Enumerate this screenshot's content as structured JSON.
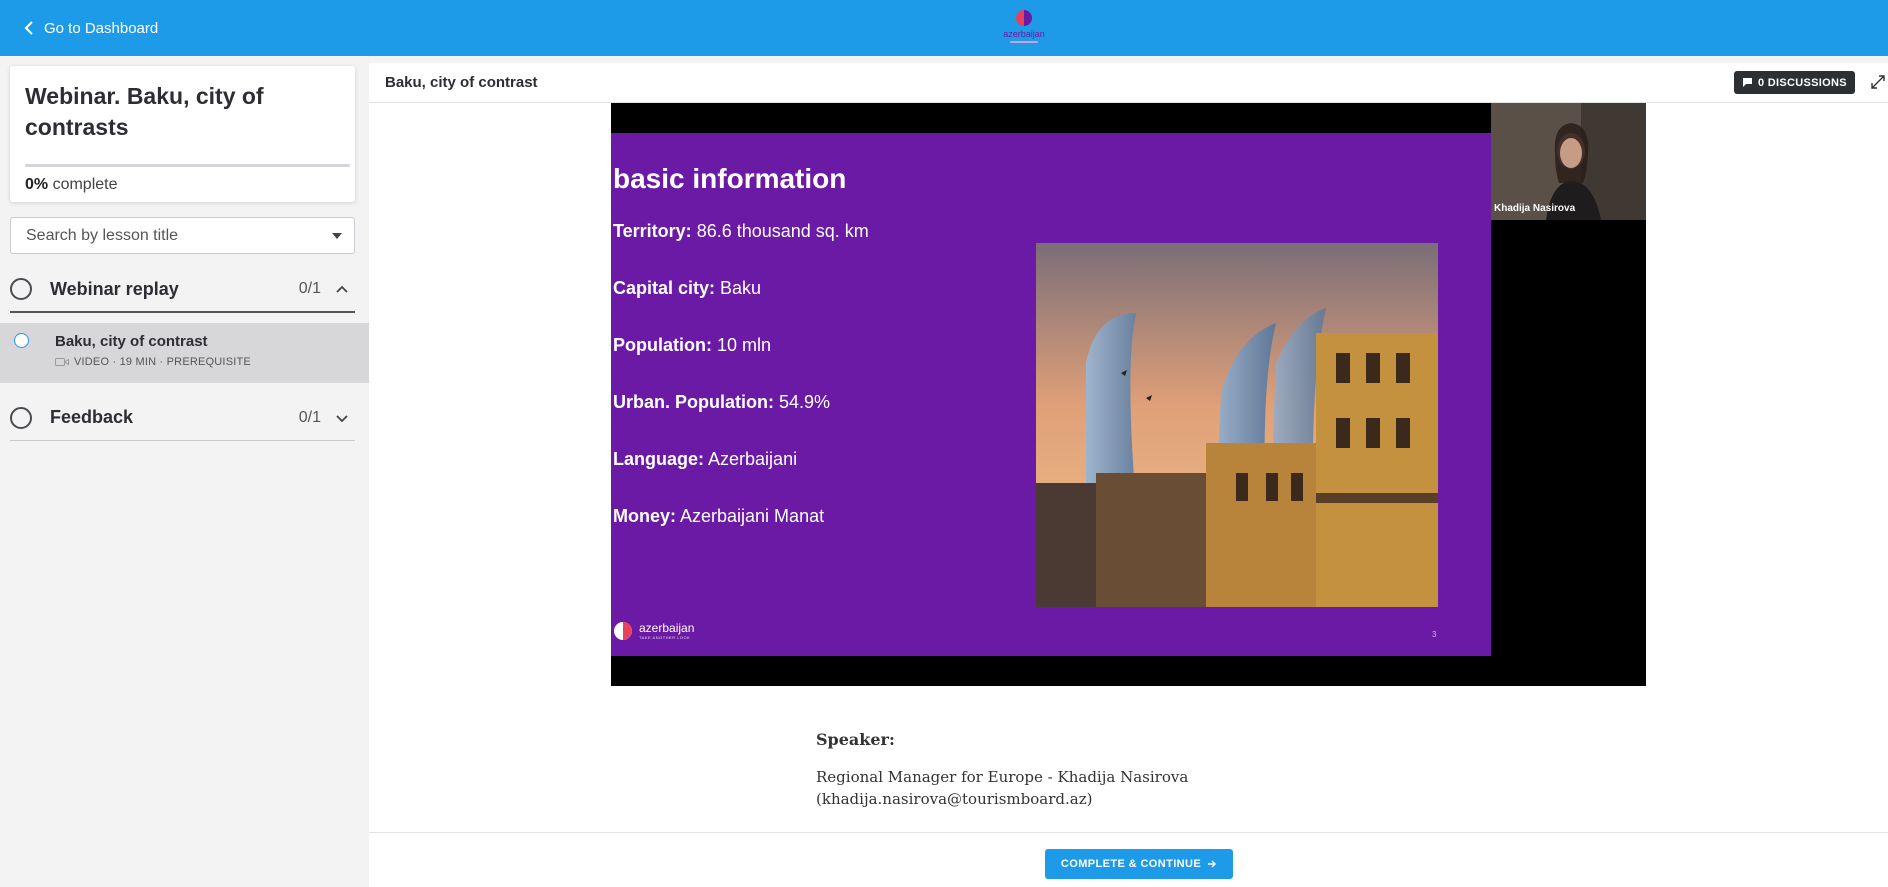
{
  "topbar": {
    "back_label": "Go to Dashboard",
    "brand_name": "azerbaijan",
    "color": "#1d9be8"
  },
  "sidebar": {
    "course_title": "Webinar. Baku, city of contrasts",
    "progress_value": "0%",
    "progress_suffix": "complete",
    "progress_fraction": 0,
    "search_placeholder": "Search by lesson title",
    "sections": [
      {
        "title": "Webinar replay",
        "count": "0/1",
        "expanded": true,
        "lessons": [
          {
            "title": "Baku, city of contrast",
            "meta": "VIDEO · 19 MIN · PREREQUISITE",
            "icon": "video-camera-icon"
          }
        ]
      },
      {
        "title": "Feedback",
        "count": "0/1",
        "expanded": false
      }
    ]
  },
  "main": {
    "lesson_title": "Baku, city of contrast",
    "discussions_label": "0 DISCUSSIONS",
    "slide": {
      "heading": "basic information",
      "facts": [
        {
          "label": "Territory:",
          "value": " 86.6 thousand sq. km"
        },
        {
          "label": "Capital city:",
          "value": " Baku"
        },
        {
          "label": "Population:",
          "value": " 10 mln"
        },
        {
          "label": "Urban. Population:",
          "value": " 54.9%"
        },
        {
          "label": "Language:",
          "value": " Azerbaijani"
        },
        {
          "label": "Money:",
          "value": " Azerbaijani Manat"
        }
      ],
      "logo_text": "azerbaijan",
      "logo_tagline": "TAKE ANOTHER LOOK",
      "page_number": "3",
      "bg_color": "#6a1aa5"
    },
    "camera_name": "Khadija Nasirova",
    "speaker_label": "Speaker:",
    "speaker_line1": "Regional Manager for Europe - Khadija Nasirova",
    "speaker_line2": "(khadija.nasirova@tourismboard.az)"
  },
  "footer": {
    "complete_label": "COMPLETE & CONTINUE"
  }
}
